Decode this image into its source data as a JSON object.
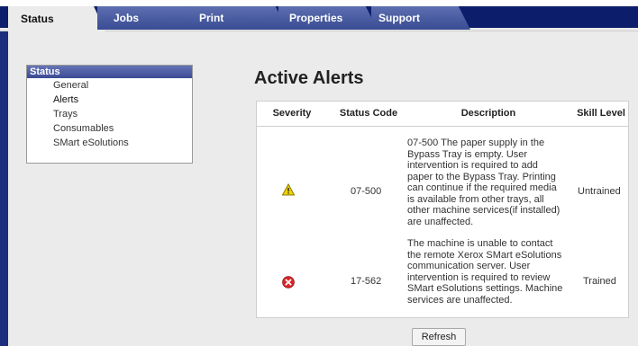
{
  "tabs": [
    {
      "label": "Status",
      "active": true
    },
    {
      "label": "Jobs",
      "active": false
    },
    {
      "label": "Print",
      "active": false
    },
    {
      "label": "Properties",
      "active": false
    },
    {
      "label": "Support",
      "active": false
    }
  ],
  "sidebar": {
    "heading": "Status",
    "items": [
      {
        "label": "General"
      },
      {
        "label": "Alerts"
      },
      {
        "label": "Trays"
      },
      {
        "label": "Consumables"
      },
      {
        "label": "SMart eSolutions"
      }
    ]
  },
  "main": {
    "title": "Active Alerts",
    "table": {
      "headers": [
        "Severity",
        "Status Code",
        "Description",
        "Skill Level"
      ],
      "rows": [
        {
          "severity_icon": "warning-triangle-icon",
          "status_code": "07-500",
          "description": "07-500 The paper supply in the Bypass Tray is empty. User intervention is required to add paper to the Bypass Tray. Printing can continue if the required media is available from other trays, all other machine services(if installed) are unaffected.",
          "skill_level": "Untrained"
        },
        {
          "severity_icon": "error-circle-icon",
          "status_code": "17-562",
          "description": "The machine is unable to contact the remote Xerox SMart eSolutions communication server. User intervention is required to review SMart eSolutions settings. Machine services are unaffected.",
          "skill_level": "Trained"
        }
      ]
    },
    "refresh_label": "Refresh"
  },
  "colors": {
    "bar": "#0c1e6b",
    "tab_inactive": "#3a4c93",
    "content_bg": "#ebebeb",
    "warning": "#f2d200",
    "error": "#d8262b"
  }
}
